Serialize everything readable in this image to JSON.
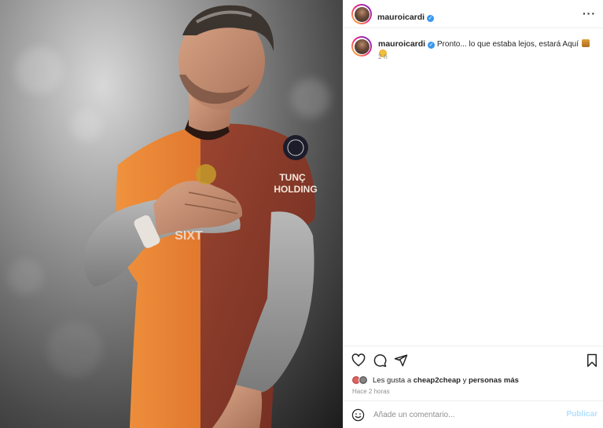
{
  "post": {
    "username": "mauroicardi",
    "verified_icon": "verified-badge-icon",
    "photo_alt": "Jugador con la camiseta naranja y granate con la mano en el pecho"
  },
  "header": {
    "username": "mauroicardi",
    "more_label": "···"
  },
  "caption": {
    "username": "mauroicardi",
    "text": "Pronto... lo que estaba lejos, estará Aquí",
    "time": "2 h"
  },
  "photo": {
    "shirt_sponsor": "TUNÇ HOLDING",
    "shirt_text": "SIXT"
  },
  "actions": {
    "likes_prefix": "Les gusta a",
    "likes_user": "cheap2cheap",
    "likes_middle": "y",
    "likes_others": "personas más",
    "posted_ago": "Hace 2 horas"
  },
  "comment": {
    "placeholder": "Añade un comentario...",
    "post_label": "Publicar"
  },
  "colors": {
    "accent": "#3897f0",
    "post_disabled": "#b2dffc",
    "secondary_text": "#8e8e8e",
    "shirt_orange": "#e8833a",
    "shirt_maroon": "#8a3a2a"
  }
}
